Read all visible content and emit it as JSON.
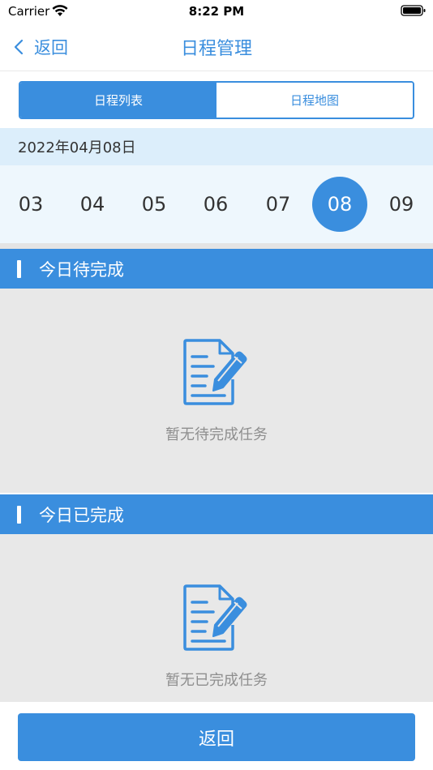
{
  "status_bar": {
    "carrier": "Carrier",
    "time": "8:22 PM",
    "wifi_icon": "wifi-icon",
    "battery_icon": "battery-icon"
  },
  "nav": {
    "back_label": "返回",
    "back_icon": "chevron-left-icon",
    "title": "日程管理"
  },
  "tabs": [
    {
      "label": "日程列表",
      "active": true
    },
    {
      "label": "日程地图",
      "active": false
    }
  ],
  "date_header": "2022年04月08日",
  "days": [
    {
      "label": "03",
      "selected": false
    },
    {
      "label": "04",
      "selected": false
    },
    {
      "label": "05",
      "selected": false
    },
    {
      "label": "06",
      "selected": false
    },
    {
      "label": "07",
      "selected": false
    },
    {
      "label": "08",
      "selected": true
    },
    {
      "label": "09",
      "selected": false
    }
  ],
  "sections": [
    {
      "title": "今日待完成",
      "empty_text": "暂无待完成任务",
      "icon": "document-edit-icon"
    },
    {
      "title": "今日已完成",
      "empty_text": "暂无已完成任务",
      "icon": "document-edit-icon"
    }
  ],
  "bottom_button_label": "返回",
  "colors": {
    "accent": "#3a8ede",
    "date_header_bg": "#dceefb",
    "day_strip_bg": "#eef7fd",
    "empty_bg": "#e8e8e8",
    "empty_text": "#8e8e8e"
  }
}
